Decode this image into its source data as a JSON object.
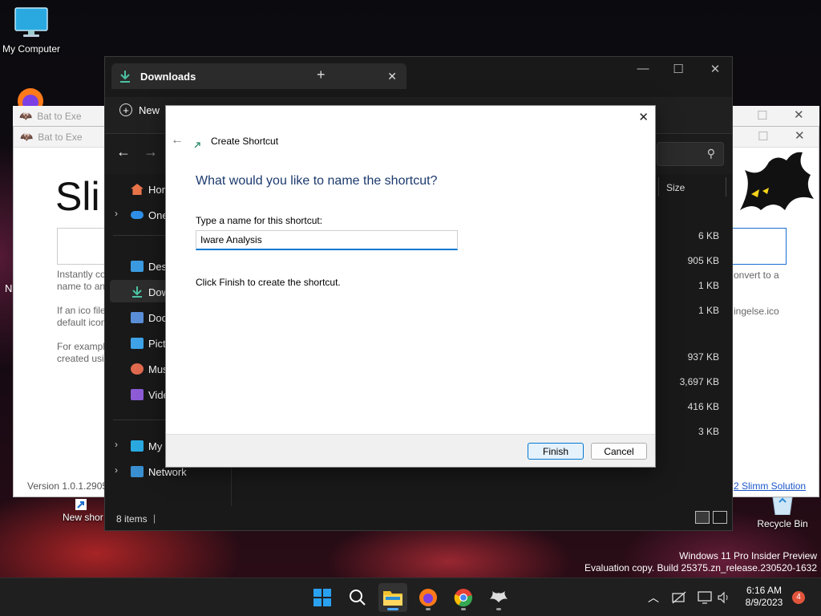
{
  "desktop": {
    "icons": {
      "my_computer": "My Computer",
      "new_shortcut": "New shor",
      "recycle_bin": "Recycle Bin"
    },
    "watermark": {
      "line1": "Windows 11 Pro Insider Preview",
      "line2": "Evaluation copy. Build 25375.zn_release.230520-1632"
    }
  },
  "bat_windows": {
    "title1": "Bat to Exe",
    "title2": "Bat to Exe",
    "heading": "Sli",
    "desc1a": "Instantly co",
    "desc1b": "name to an",
    "desc2a": "If an ico file",
    "desc2b": "default icon",
    "desc3a": "For exampl",
    "desc3b": "created usi",
    "version": "Version 1.0.1.29055",
    "right_text1": "onvert to a",
    "right_text2": "ingelse.ico",
    "footer_link": "2 Slimm Solution",
    "edge_letter": "N"
  },
  "explorer": {
    "tab_title": "Downloads",
    "new_label": "New",
    "sidebar": {
      "home": "Hor",
      "onedrive": "One",
      "desktop": "Desl",
      "downloads": "Dow",
      "documents": "Doc",
      "pictures": "Pict",
      "music": "Mus",
      "videos": "Vide",
      "my_computer": "My",
      "network": "Network"
    },
    "column_size": "Size",
    "sizes": [
      "6 KB",
      "905 KB",
      "1 KB",
      "1 KB",
      "937 KB",
      "3,697 KB",
      "416 KB",
      "3 KB"
    ],
    "status_items": "8 items"
  },
  "dialog": {
    "title": "Create Shortcut",
    "heading": "What would you like to name the shortcut?",
    "name_label": "Type a name for this shortcut:",
    "name_value": "Iware Analysis",
    "hint": "Click Finish to create the shortcut.",
    "finish": "Finish",
    "cancel": "Cancel"
  },
  "taskbar": {
    "time": "6:16 AM",
    "date": "8/9/2023",
    "notification_count": "4"
  },
  "colors": {
    "accent": "#0078d4",
    "dialog_heading": "#1c3a6e",
    "download_green": "#4cc2a3",
    "notification_badge": "#e2553c"
  }
}
